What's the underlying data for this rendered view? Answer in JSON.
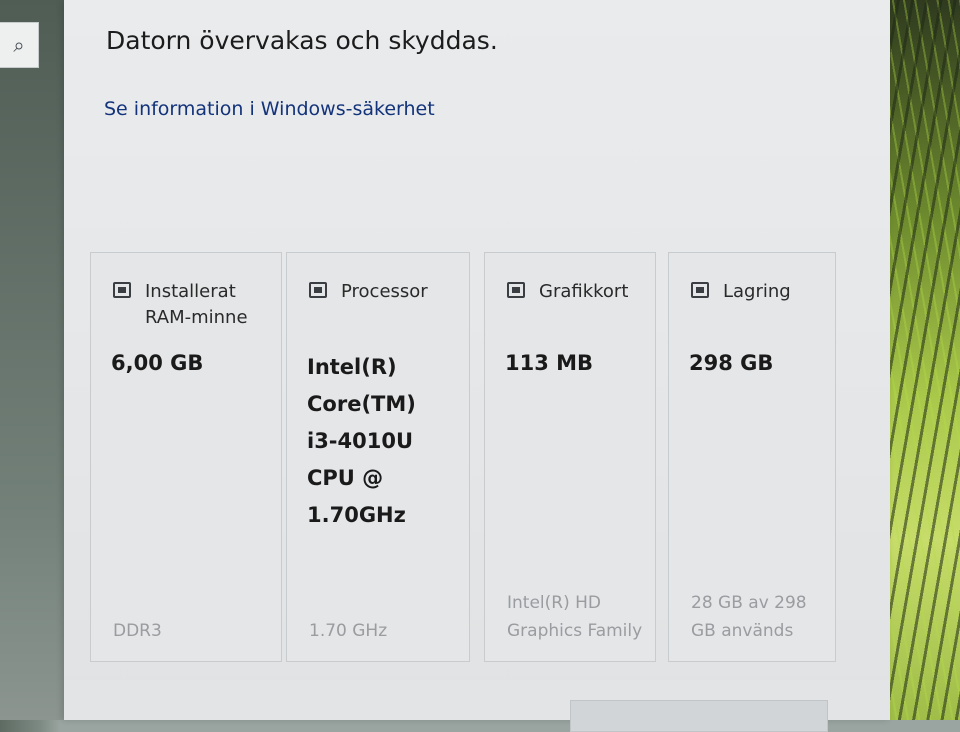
{
  "status": {
    "title": "Datorn övervakas och skyddas.",
    "link": "Se information i Windows-säkerhet"
  },
  "search": {
    "icon": "search-icon",
    "glyph": "⌕"
  },
  "cards": [
    {
      "icon": "ram-icon",
      "label": "Installerat RAM-minne",
      "value": "6,00 GB",
      "detail": "DDR3"
    },
    {
      "icon": "processor-icon",
      "label": "Processor",
      "value": "Intel(R) Core(TM) i3-4010U CPU @ 1.70GHz",
      "detail": "1.70 GHz"
    },
    {
      "icon": "graphics-card-icon",
      "label": "Grafikkort",
      "value": "113 MB",
      "detail": "Intel(R) HD Graphics Family"
    },
    {
      "icon": "storage-icon",
      "label": "Lagring",
      "value": "298 GB",
      "detail": "28 GB av 298 GB används"
    }
  ]
}
